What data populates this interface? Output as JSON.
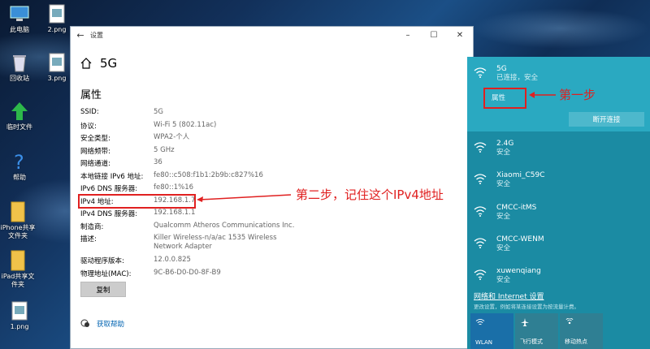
{
  "desktop": {
    "icons": [
      {
        "label": "此电脑",
        "icon": "computer-icon"
      },
      {
        "label": "2.png",
        "icon": "image-file-icon"
      },
      {
        "label": "回收站",
        "icon": "recycle-bin-icon"
      },
      {
        "label": "3.png",
        "icon": "image-file-icon"
      },
      {
        "label": "临时文件",
        "icon": "green-arrow-icon"
      },
      {
        "label": "帮助",
        "icon": "help-icon"
      },
      {
        "label": "iPhone共享文件夹",
        "icon": "folder-icon"
      },
      {
        "label": "iPad共享文件夹",
        "icon": "folder-icon"
      },
      {
        "label": "1.png",
        "icon": "image-file-icon"
      }
    ]
  },
  "settings": {
    "title": "设置",
    "network_name": "5G",
    "section": "属性",
    "properties": [
      {
        "key": "SSID:",
        "value": "5G"
      },
      {
        "key": "协议:",
        "value": "Wi-Fi 5 (802.11ac)"
      },
      {
        "key": "安全类型:",
        "value": "WPA2-个人"
      },
      {
        "key": "网络频带:",
        "value": "5 GHz"
      },
      {
        "key": "网络通道:",
        "value": "36"
      },
      {
        "key": "本地链接 IPv6 地址:",
        "value": "fe80::c508:f1b1:2b9b:c827%16"
      },
      {
        "key": "IPv6 DNS 服务器:",
        "value": "fe80::1%16"
      },
      {
        "key": "IPv4 地址:",
        "value": "192.168.1.7"
      },
      {
        "key": "IPv4 DNS 服务器:",
        "value": "192.168.1.1"
      },
      {
        "key": "制造商:",
        "value": "Qualcomm Atheros Communications Inc."
      },
      {
        "key": "描述:",
        "value": "Killer Wireless-n/a/ac 1535 Wireless Network Adapter"
      },
      {
        "key": "驱动程序版本:",
        "value": "12.0.0.825"
      },
      {
        "key": "物理地址(MAC):",
        "value": "9C-B6-D0-D0-8F-B9"
      }
    ],
    "copy_button": "复制",
    "help_link": "获取帮助"
  },
  "annotations": {
    "step1": "第一步",
    "step2": "第二步，记住这个IPv4地址",
    "color": "#e02020"
  },
  "flyout": {
    "active": {
      "name": "5G",
      "status": "已连接，安全",
      "properties_link": "属性",
      "disconnect": "断开连接"
    },
    "networks": [
      {
        "name": "2.4G",
        "status": "安全"
      },
      {
        "name": "Xiaomi_C59C",
        "status": "安全"
      },
      {
        "name": "CMCC-itMS",
        "status": "安全"
      },
      {
        "name": "CMCC-WENM",
        "status": "安全"
      },
      {
        "name": "xuwenqiang",
        "status": "安全"
      }
    ],
    "settings_link": "网络和 Internet 设置",
    "settings_sub": "更改设置，例如将某连接设置为按流量计费。",
    "tiles": [
      {
        "label": "WLAN",
        "icon": "wifi-icon",
        "active": true
      },
      {
        "label": "飞行模式",
        "icon": "airplane-icon",
        "active": false
      },
      {
        "label": "移动热点",
        "icon": "hotspot-icon",
        "active": false
      }
    ],
    "accent": "#1b8ba3"
  }
}
